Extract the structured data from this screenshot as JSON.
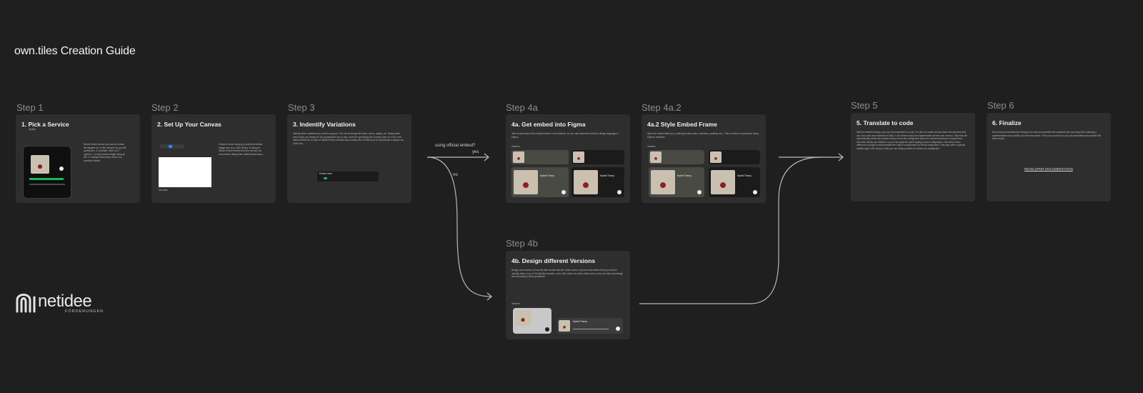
{
  "title": "own.tiles Creation Guide",
  "steps": [
    {
      "label": "Step 1",
      "title": "1. Pick a Service",
      "subtitle": "Spotify",
      "text": "Decide which service you want to create the widgets for. In this example we go with spotify.com. In principle, there are 2 options: 1. A fully custom widget using an API 2. A widget that mainly relies on a provided embed"
    },
    {
      "label": "Step 2",
      "title": "2. Set Up Your Canvas",
      "text": "Create a frame using your preferred default widget size (e.g. 400x 300px). If using an official iFrame embed from the service, we recommend taking them default dimensions.",
      "frame_caption": "own-tiles"
    },
    {
      "label": "Step 3",
      "title": "3. Indentify Variations",
      "text": "Identify which variations you want to support. This can be things like sizes, colors, styling, etc. Noting them down helps you design for all combinations and is also useful for specifying the Customs later on in the next steps framework. In case of official iFrame embeds they usually offer a limited set of customization options out of the box.",
      "panel_title": "Embed tuner"
    },
    {
      "label": "Step 4a",
      "title": "4a. Get embed into Figma",
      "text": "Take screenshots of the official embed in all variations, so you can experiment with the design language in Figma.",
      "variant_label": "Variants"
    },
    {
      "label": "Step 4a.2",
      "title": "4a.2 Style Embed Frame",
      "text": "Style the embed frame (e.g. defining border radius, shadows, padding, etc.). This is useful to experiment using Figma's variables.",
      "variant_label": "Variants"
    },
    {
      "label": "Step 4b",
      "title": "4b. Design different Versions",
      "text": "Design and versions of how the tiles should look like. Make sure to only use information that your service actually offers. (e.g. in the Spotify example: cover, title, artist, etc.) Also make sure to only use data accordingly when branding of their guidelines.",
      "variant_label": "Variants"
    },
    {
      "label": "Step 5",
      "title": "5. Translate to code",
      "text": "With the finished design, you can now translate it to code. For this it is useful to think about the structure that can occur and was examined in Step 3. All of them should be implemented as their own version. Then this will automatically create the needed wiring so that the configurator offers the needed elements to adapt them. Own tiles strictly use Tailwind, so you can apply the same styling to your configuration. Own tiles is also offered as a plugin to help translate the Figma components to a React component. They also offer a specific walkthrough in the setup so that you can easily provide it to others via configurator."
    },
    {
      "label": "Step 6",
      "title": "6. Finalize",
      "text": "Now that you translated the Design into code and specified the variations the only thing left is defining a implementation and publish your tiles the author. Then you can add it to your documentation and publish the final version.",
      "link": "DEVELOPER DOCUMENTATION"
    }
  ],
  "branches": {
    "question": "using official embed?",
    "yes": "yes",
    "no": "no"
  },
  "logo": {
    "name": "netidee",
    "tagline": "FÖRDERUNGEN"
  },
  "album_title": "Hybrid Theory",
  "colors": {
    "background": "#1f1f1f",
    "card": "#2e2e2e",
    "accent": "#1db954"
  }
}
